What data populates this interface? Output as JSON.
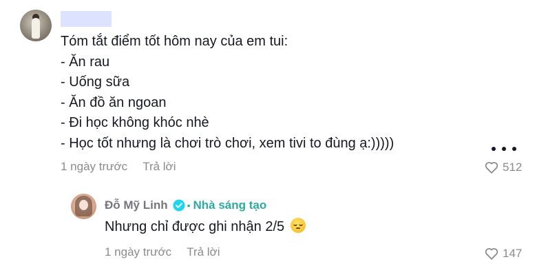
{
  "comment": {
    "lines": [
      "Tóm tắt điểm tốt hôm nay của em tui:",
      "- Ăn rau",
      "- Uống sữa",
      "- Ăn đồ ăn ngoan",
      "- Đi học không khóc nhè",
      "- Học tốt nhưng là chơi trò chơi, xem tivi to đùng ạ:)))))"
    ],
    "time": "1 ngày trước",
    "reply_label": "Trả lời",
    "like_count": "512"
  },
  "reply": {
    "author": "Đỗ Mỹ Linh",
    "separator": "•",
    "creator_tag": "Nhà sáng tạo",
    "text": "Nhưng chỉ được ghi nhận 2/5",
    "emoji": "relieved-face",
    "time": "1 ngày trước",
    "reply_label": "Trả lời",
    "like_count": "147"
  },
  "colors": {
    "text": "#161823",
    "muted": "#8a8b91",
    "creator": "#2eaaa0",
    "verified": "#20d5ec",
    "redaction": "#dde3ff"
  },
  "icons": {
    "more": "more-dots-icon",
    "like": "heart-outline-icon",
    "verified": "verified-badge-icon"
  }
}
